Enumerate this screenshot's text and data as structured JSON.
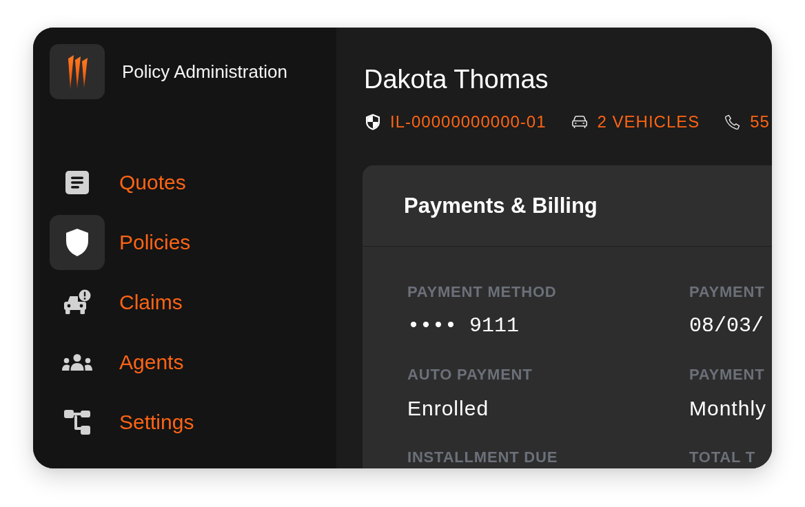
{
  "sidebar": {
    "app_title": "Policy Administration",
    "items": [
      {
        "label": "Quotes",
        "kind": "quotes",
        "selected": false
      },
      {
        "label": "Policies",
        "kind": "policies",
        "selected": true
      },
      {
        "label": "Claims",
        "kind": "claims",
        "selected": false
      },
      {
        "label": "Agents",
        "kind": "agents",
        "selected": false
      },
      {
        "label": "Settings",
        "kind": "settings",
        "selected": false
      }
    ]
  },
  "customer": {
    "name": "Dakota Thomas",
    "details": [
      {
        "kind": "policy",
        "text": "IL-00000000000-01"
      },
      {
        "kind": "vehicles",
        "text": "2 VEHICLES"
      },
      {
        "kind": "phone",
        "text": "55"
      }
    ]
  },
  "billing": {
    "title": "Payments & Billing",
    "fields": [
      {
        "label": "PAYMENT METHOD",
        "value": "•••• 9111",
        "kind": "mono"
      },
      {
        "label": "PAYMENT",
        "value": "08/03/",
        "kind": "mono"
      },
      {
        "label": "AUTO PAYMENT",
        "value": "Enrolled",
        "kind": "text"
      },
      {
        "label": "PAYMENT",
        "value": "Monthly",
        "kind": "text"
      },
      {
        "label": "INSTALLMENT DUE"
      },
      {
        "label": "TOTAL T"
      }
    ]
  }
}
